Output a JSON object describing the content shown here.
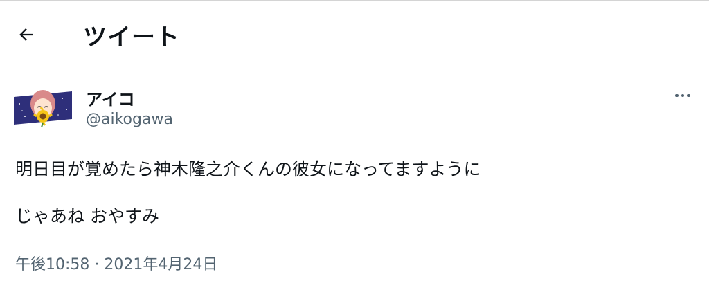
{
  "header": {
    "title": "ツイート",
    "back_icon": "arrow-left-icon"
  },
  "tweet": {
    "display_name": "アイコ",
    "handle": "@aikogawa",
    "more_icon": "more-horizontal-icon",
    "text_lines": [
      "明日目が覚めたら神木隆之介くんの彼女になってますように",
      "じゃあね おやすみ"
    ],
    "timestamp": "午後10:58 · 2021年4月24日"
  },
  "colors": {
    "text_primary": "#0f1419",
    "text_secondary": "#536471",
    "background": "#ffffff"
  }
}
